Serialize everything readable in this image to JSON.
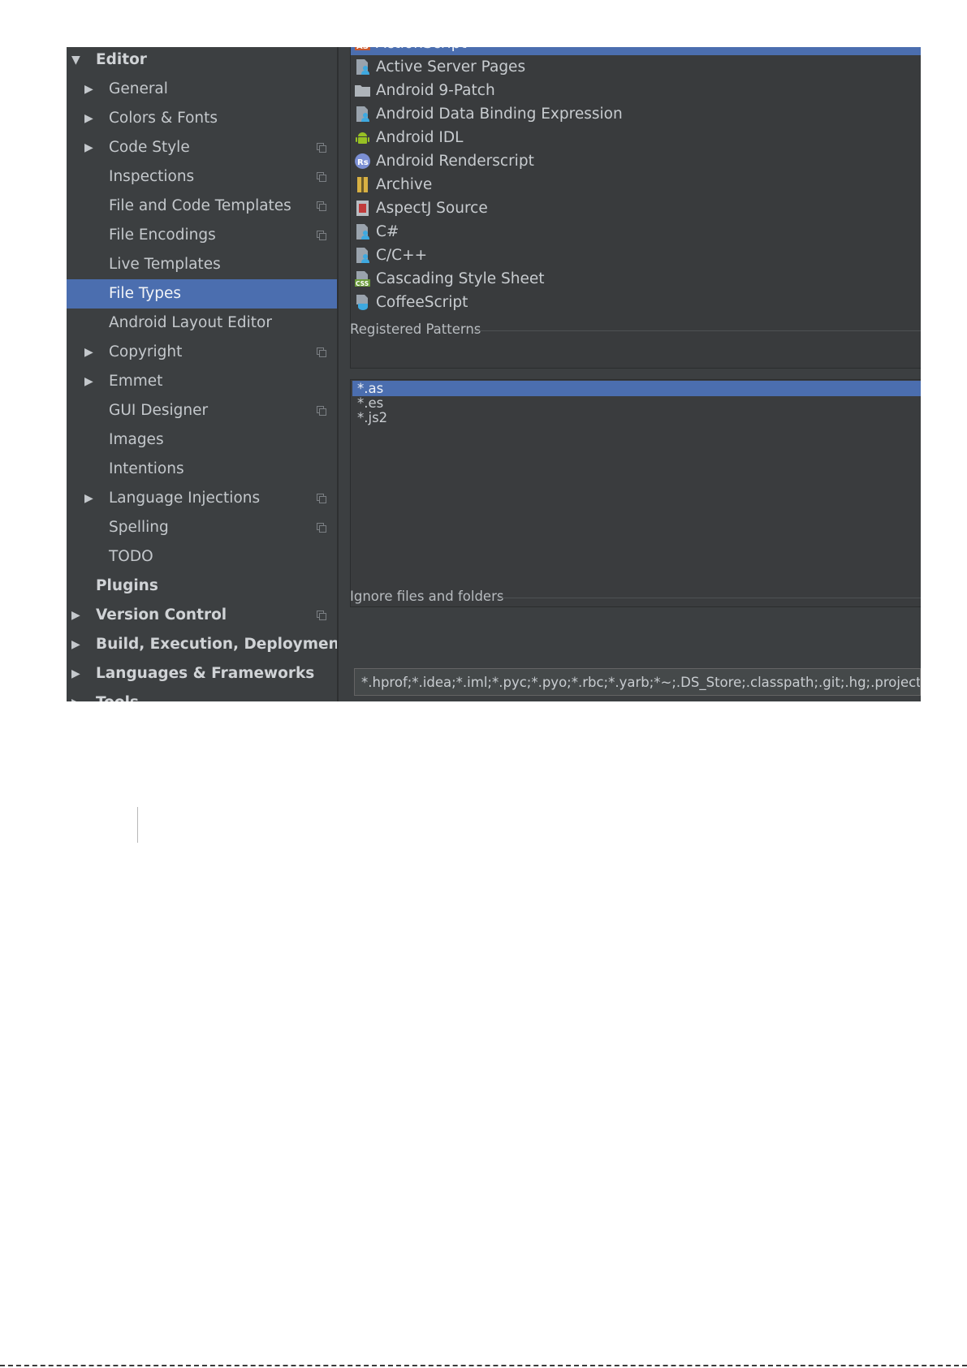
{
  "tree": [
    {
      "label": "Editor",
      "level": 0,
      "arrow": "▼",
      "bold": true
    },
    {
      "label": "General",
      "level": 1,
      "arrow": "▶"
    },
    {
      "label": "Colors & Fonts",
      "level": 1,
      "arrow": "▶"
    },
    {
      "label": "Code Style",
      "level": 1,
      "arrow": "▶",
      "project": true
    },
    {
      "label": "Inspections",
      "level": 1,
      "project": true
    },
    {
      "label": "File and Code Templates",
      "level": 1,
      "project": true
    },
    {
      "label": "File Encodings",
      "level": 1,
      "project": true
    },
    {
      "label": "Live Templates",
      "level": 1
    },
    {
      "label": "File Types",
      "level": 1,
      "selected": true
    },
    {
      "label": "Android Layout Editor",
      "level": 1
    },
    {
      "label": "Copyright",
      "level": 1,
      "arrow": "▶",
      "project": true
    },
    {
      "label": "Emmet",
      "level": 1,
      "arrow": "▶"
    },
    {
      "label": "GUI Designer",
      "level": 1,
      "project": true
    },
    {
      "label": "Images",
      "level": 1
    },
    {
      "label": "Intentions",
      "level": 1
    },
    {
      "label": "Language Injections",
      "level": 1,
      "arrow": "▶",
      "project": true
    },
    {
      "label": "Spelling",
      "level": 1,
      "project": true
    },
    {
      "label": "TODO",
      "level": 1
    },
    {
      "label": "Plugins",
      "level": 0,
      "bold": true
    },
    {
      "label": "Version Control",
      "level": 0,
      "arrow": "▶",
      "bold": true,
      "project": true
    },
    {
      "label": "Build, Execution, Deployment",
      "level": 0,
      "arrow": "▶",
      "bold": true
    },
    {
      "label": "Languages & Frameworks",
      "level": 0,
      "arrow": "▶",
      "bold": true
    },
    {
      "label": "Tools",
      "level": 0,
      "arrow": "▶",
      "bold": true
    }
  ],
  "file_types": [
    {
      "label": "ActionScript",
      "icon": "actionscript-icon",
      "selected": true
    },
    {
      "label": "Active Server Pages",
      "icon": "asp-file-icon"
    },
    {
      "label": "Android 9-Patch",
      "icon": "folder-icon"
    },
    {
      "label": "Android Data Binding Expression",
      "icon": "data-binding-file-icon"
    },
    {
      "label": "Android IDL",
      "icon": "android-icon"
    },
    {
      "label": "Android Renderscript",
      "icon": "renderscript-icon"
    },
    {
      "label": "Archive",
      "icon": "archive-icon"
    },
    {
      "label": "AspectJ Source",
      "icon": "aspectj-icon"
    },
    {
      "label": "C#",
      "icon": "csharp-file-icon"
    },
    {
      "label": "C/C++",
      "icon": "cpp-file-icon"
    },
    {
      "label": "Cascading Style Sheet",
      "icon": "css-icon"
    },
    {
      "label": "CoffeeScript",
      "icon": "coffeescript-icon"
    }
  ],
  "registered_patterns": {
    "title": "Registered Patterns",
    "items": [
      {
        "label": "*.as",
        "selected": true
      },
      {
        "label": "*.es"
      },
      {
        "label": "*.js2"
      }
    ]
  },
  "ignore": {
    "title": "Ignore files and folders",
    "value": "*.hprof;*.idea;*.iml;*.pyc;*.pyo;*.rbc;*.yarb;*~;.DS_Store;.classpath;.git;.hg;.project;.s"
  },
  "colors": {
    "background": "#3c3f41",
    "selection": "#4b6eaf",
    "text": "#c4c8cc"
  }
}
